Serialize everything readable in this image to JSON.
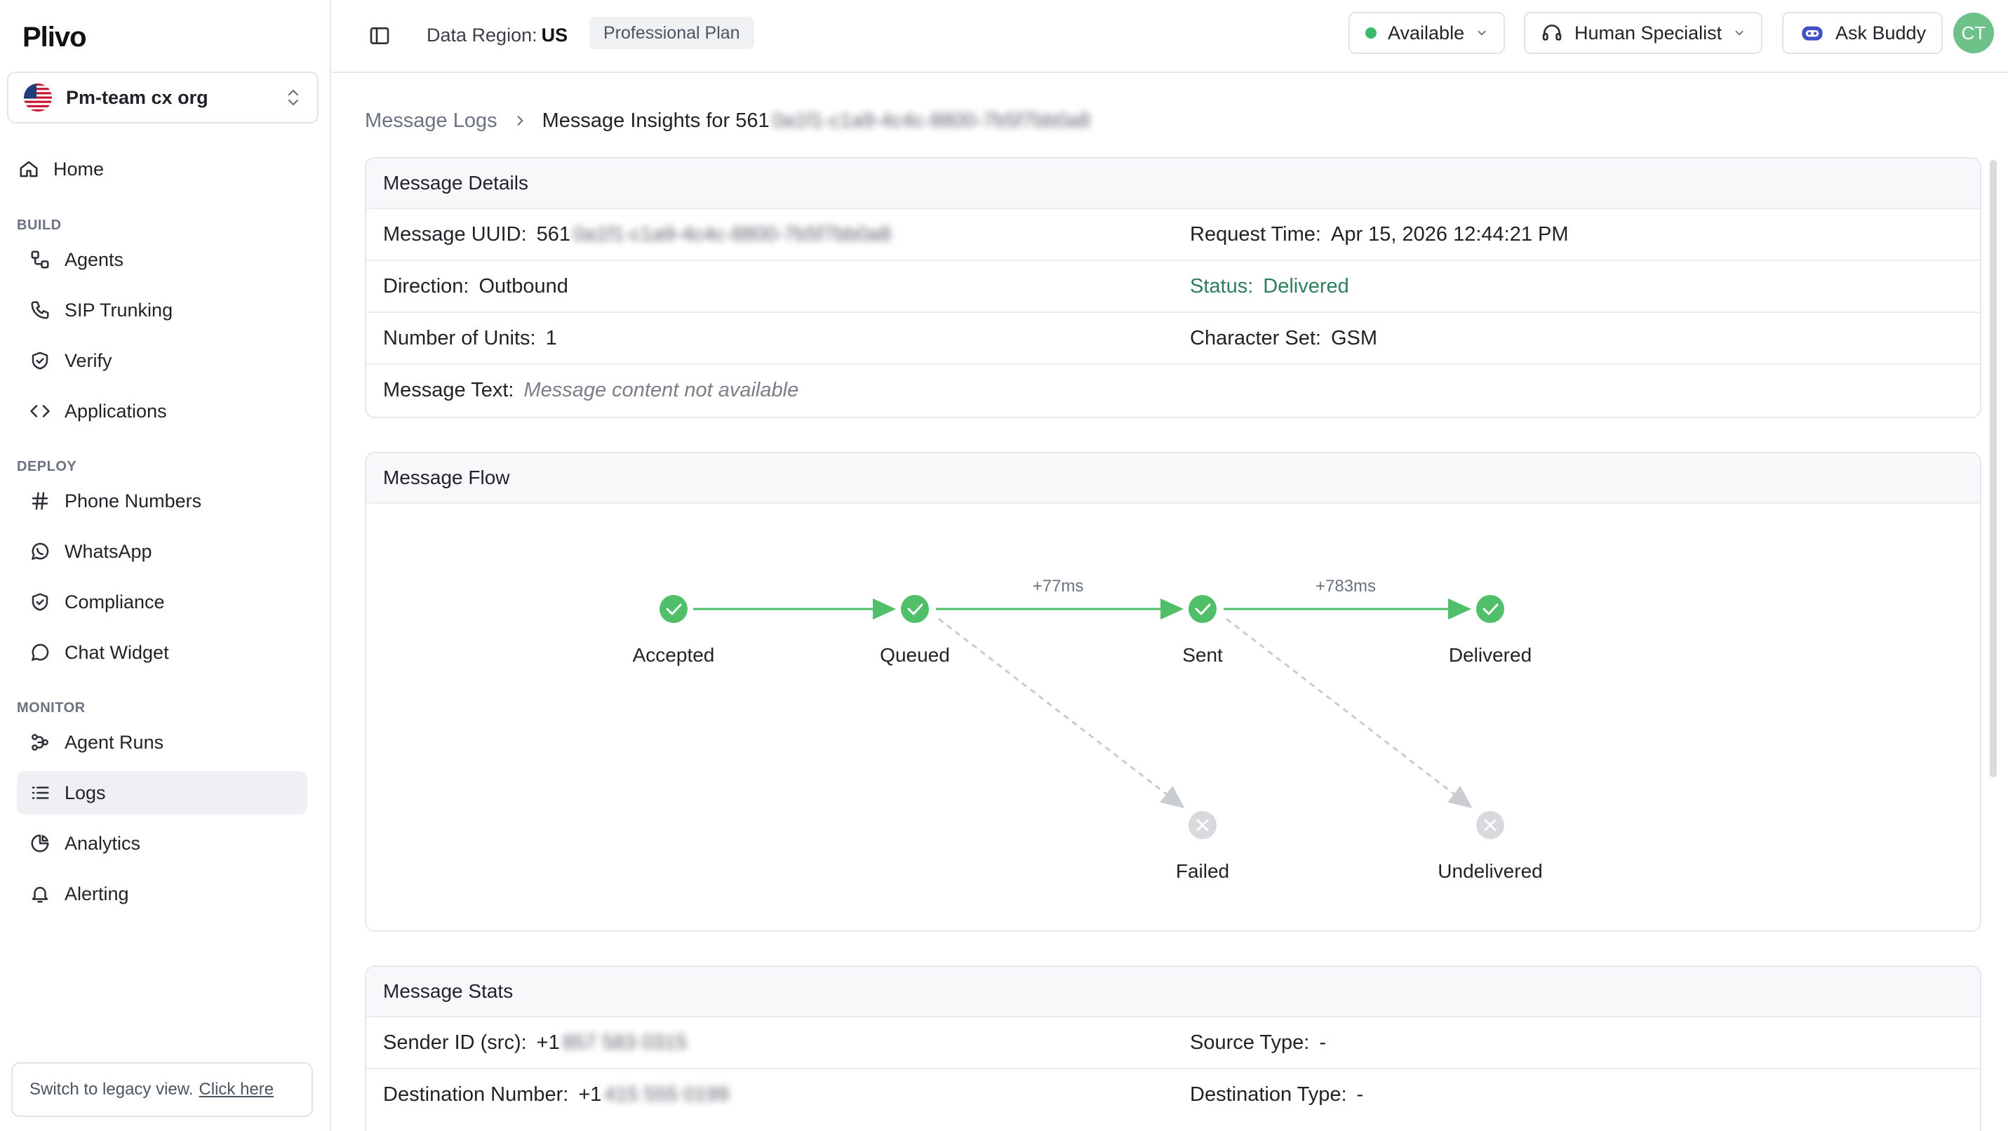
{
  "app": {
    "logo": "Plivo"
  },
  "org": {
    "name": "Pm-team cx org"
  },
  "sidebar": {
    "home": "Home",
    "sections": {
      "build": "BUILD",
      "deploy": "DEPLOY",
      "monitor": "MONITOR"
    },
    "build_items": [
      "Agents",
      "SIP Trunking",
      "Verify",
      "Applications"
    ],
    "deploy_items": [
      "Phone Numbers",
      "WhatsApp",
      "Compliance",
      "Chat Widget"
    ],
    "monitor_items": [
      "Agent Runs",
      "Logs",
      "Analytics",
      "Alerting"
    ],
    "active_item": "Logs",
    "legacy": {
      "text": "Switch to legacy view.",
      "link": "Click here"
    }
  },
  "topbar": {
    "region_label": "Data Region:",
    "region_value": "US",
    "plan": "Professional Plan",
    "availability": "Available",
    "availability_color": "#3cb86a",
    "specialist": "Human Specialist",
    "ask": "Ask Buddy",
    "avatar_initials": "CT"
  },
  "breadcrumb": {
    "parent": "Message Logs",
    "current_prefix": "Message Insights for 561",
    "current_redacted": "0a1f1-c1a9-4c4c-8800-7b5f7bb0a8"
  },
  "details": {
    "title": "Message Details",
    "uuid_label": "Message UUID:",
    "uuid_prefix": "561",
    "uuid_redacted": "0a1f1-c1a9-4c4c-8800-7b5f7bb0a8",
    "request_time_label": "Request Time:",
    "request_time": "Apr 15, 2026 12:44:21 PM",
    "direction_label": "Direction:",
    "direction": "Outbound",
    "status_label": "Status:",
    "status": "Delivered",
    "status_color": "#2e7d5b",
    "units_label": "Number of Units:",
    "units": "1",
    "charset_label": "Character Set:",
    "charset": "GSM",
    "text_label": "Message Text:",
    "text": "Message content not available"
  },
  "flow": {
    "title": "Message Flow",
    "nodes": {
      "accepted": "Accepted",
      "queued": "Queued",
      "sent": "Sent",
      "delivered": "Delivered",
      "failed": "Failed",
      "undelivered": "Undelivered"
    },
    "delays": {
      "queued_to_sent": "+77ms",
      "sent_to_delivered": "+783ms"
    },
    "colors": {
      "success": "#4fbf6a",
      "inactive": "#d7d9dc"
    }
  },
  "stats": {
    "title": "Message Stats",
    "sender_label": "Sender ID (src):",
    "sender_prefix": "+1",
    "sender_redacted": "857 583 0315",
    "source_type_label": "Source Type:",
    "source_type": "-",
    "dest_label": "Destination Number:",
    "dest_prefix": "+1",
    "dest_redacted": "415 555 0199",
    "dest_type_label": "Destination Type:",
    "dest_type": "-"
  }
}
